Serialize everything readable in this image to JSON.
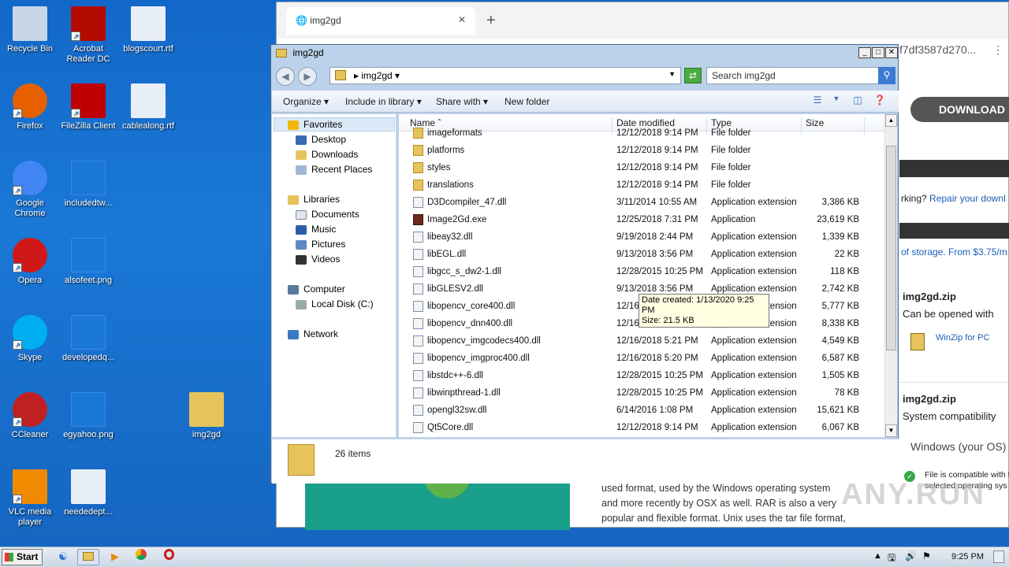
{
  "desktop": {
    "icons": [
      {
        "label": "Recycle Bin"
      },
      {
        "label": "Acrobat Reader DC"
      },
      {
        "label": "blogscourt.rtf"
      },
      {
        "label": "Firefox"
      },
      {
        "label": "FileZilla Client"
      },
      {
        "label": "cablealong.rtf"
      },
      {
        "label": "Google Chrome"
      },
      {
        "label": "includedtw..."
      },
      {
        "label": "Opera"
      },
      {
        "label": "alsofeet.png"
      },
      {
        "label": "Skype"
      },
      {
        "label": "developedq..."
      },
      {
        "label": "CCleaner"
      },
      {
        "label": "egyahoo.png"
      },
      {
        "label": "img2gd"
      },
      {
        "label": "VLC media player"
      },
      {
        "label": "neededept..."
      }
    ]
  },
  "browser": {
    "tab_title": "img2gd",
    "address_tail": "f7df3587d270...",
    "download_label": "DOWNLOAD",
    "repair_prefix": "rking?",
    "repair_link": "Repair your downl",
    "storage_text": "of storage. From $3.75/m",
    "zip1_title": "img2gd.zip",
    "zip1_sub": "Can be opened with",
    "winzip_link": "WinZip for PC",
    "zip2_title": "img2gd.zip",
    "zip2_sub": "System compatibility",
    "os_text": "Windows (your OS)",
    "compat_line1": "File is compatible with t",
    "compat_line2": "selected operating sys",
    "article": [
      "used format, used by the Windows operating system",
      "and more recently by OSX as well. RAR is also a very",
      "popular and flexible format. Unix uses the tar file format,"
    ],
    "watermark": "ANY.RUN"
  },
  "explorer": {
    "title": "img2gd",
    "breadcrumb": "img2gd",
    "search_placeholder": "Search img2gd",
    "toolbar": {
      "organize": "Organize",
      "include": "Include in library",
      "share": "Share with",
      "new_folder": "New folder"
    },
    "nav": {
      "favorites": "Favorites",
      "desktop": "Desktop",
      "downloads": "Downloads",
      "recent": "Recent Places",
      "libraries": "Libraries",
      "documents": "Documents",
      "music": "Music",
      "pictures": "Pictures",
      "videos": "Videos",
      "computer": "Computer",
      "local_disk": "Local Disk (C:)",
      "network": "Network"
    },
    "columns": {
      "name": "Name",
      "date": "Date modified",
      "type": "Type",
      "size": "Size"
    },
    "files": [
      {
        "name": "imageformats",
        "date": "12/12/2018 9:14 PM",
        "type": "File folder",
        "size": "",
        "kind": "folder"
      },
      {
        "name": "platforms",
        "date": "12/12/2018 9:14 PM",
        "type": "File folder",
        "size": "",
        "kind": "folder"
      },
      {
        "name": "styles",
        "date": "12/12/2018 9:14 PM",
        "type": "File folder",
        "size": "",
        "kind": "folder"
      },
      {
        "name": "translations",
        "date": "12/12/2018 9:14 PM",
        "type": "File folder",
        "size": "",
        "kind": "folder"
      },
      {
        "name": "D3Dcompiler_47.dll",
        "date": "3/11/2014 10:55 AM",
        "type": "Application extension",
        "size": "3,386 KB",
        "kind": "dll"
      },
      {
        "name": "Image2Gd.exe",
        "date": "12/25/2018 7:31 PM",
        "type": "Application",
        "size": "23,619 KB",
        "kind": "exe"
      },
      {
        "name": "libeay32.dll",
        "date": "9/19/2018 2:44 PM",
        "type": "Application extension",
        "size": "1,339 KB",
        "kind": "dll"
      },
      {
        "name": "libEGL.dll",
        "date": "9/13/2018 3:56 PM",
        "type": "Application extension",
        "size": "22 KB",
        "kind": "dll"
      },
      {
        "name": "libgcc_s_dw2-1.dll",
        "date": "12/28/2015 10:25 PM",
        "type": "Application extension",
        "size": "118 KB",
        "kind": "dll"
      },
      {
        "name": "libGLESV2.dll",
        "date": "9/13/2018 3:56 PM",
        "type": "Application extension",
        "size": "2,742 KB",
        "kind": "dll"
      },
      {
        "name": "libopencv_core400.dll",
        "date": "12/16/2018 5:17 PM",
        "type": "Application extension",
        "size": "5,777 KB",
        "kind": "dll"
      },
      {
        "name": "libopencv_dnn400.dll",
        "date": "12/16/2018 5:36 PM",
        "type": "Application extension",
        "size": "8,338 KB",
        "kind": "dll"
      },
      {
        "name": "libopencv_imgcodecs400.dll",
        "date": "12/16/2018 5:21 PM",
        "type": "Application extension",
        "size": "4,549 KB",
        "kind": "dll"
      },
      {
        "name": "libopencv_imgproc400.dll",
        "date": "12/16/2018 5:20 PM",
        "type": "Application extension",
        "size": "6,587 KB",
        "kind": "dll"
      },
      {
        "name": "libstdc++-6.dll",
        "date": "12/28/2015 10:25 PM",
        "type": "Application extension",
        "size": "1,505 KB",
        "kind": "dll"
      },
      {
        "name": "libwinpthread-1.dll",
        "date": "12/28/2015 10:25 PM",
        "type": "Application extension",
        "size": "78 KB",
        "kind": "dll"
      },
      {
        "name": "opengl32sw.dll",
        "date": "6/14/2016 1:08 PM",
        "type": "Application extension",
        "size": "15,621 KB",
        "kind": "dll"
      },
      {
        "name": "Qt5Core.dll",
        "date": "12/12/2018 9:14 PM",
        "type": "Application extension",
        "size": "6,067 KB",
        "kind": "dll"
      }
    ],
    "tooltip": {
      "line1": "Date created: 1/13/2020 9:25 PM",
      "line2": "Size: 21.5 KB"
    },
    "status": "26 items"
  },
  "taskbar": {
    "start": "Start",
    "clock": "9:25 PM"
  }
}
